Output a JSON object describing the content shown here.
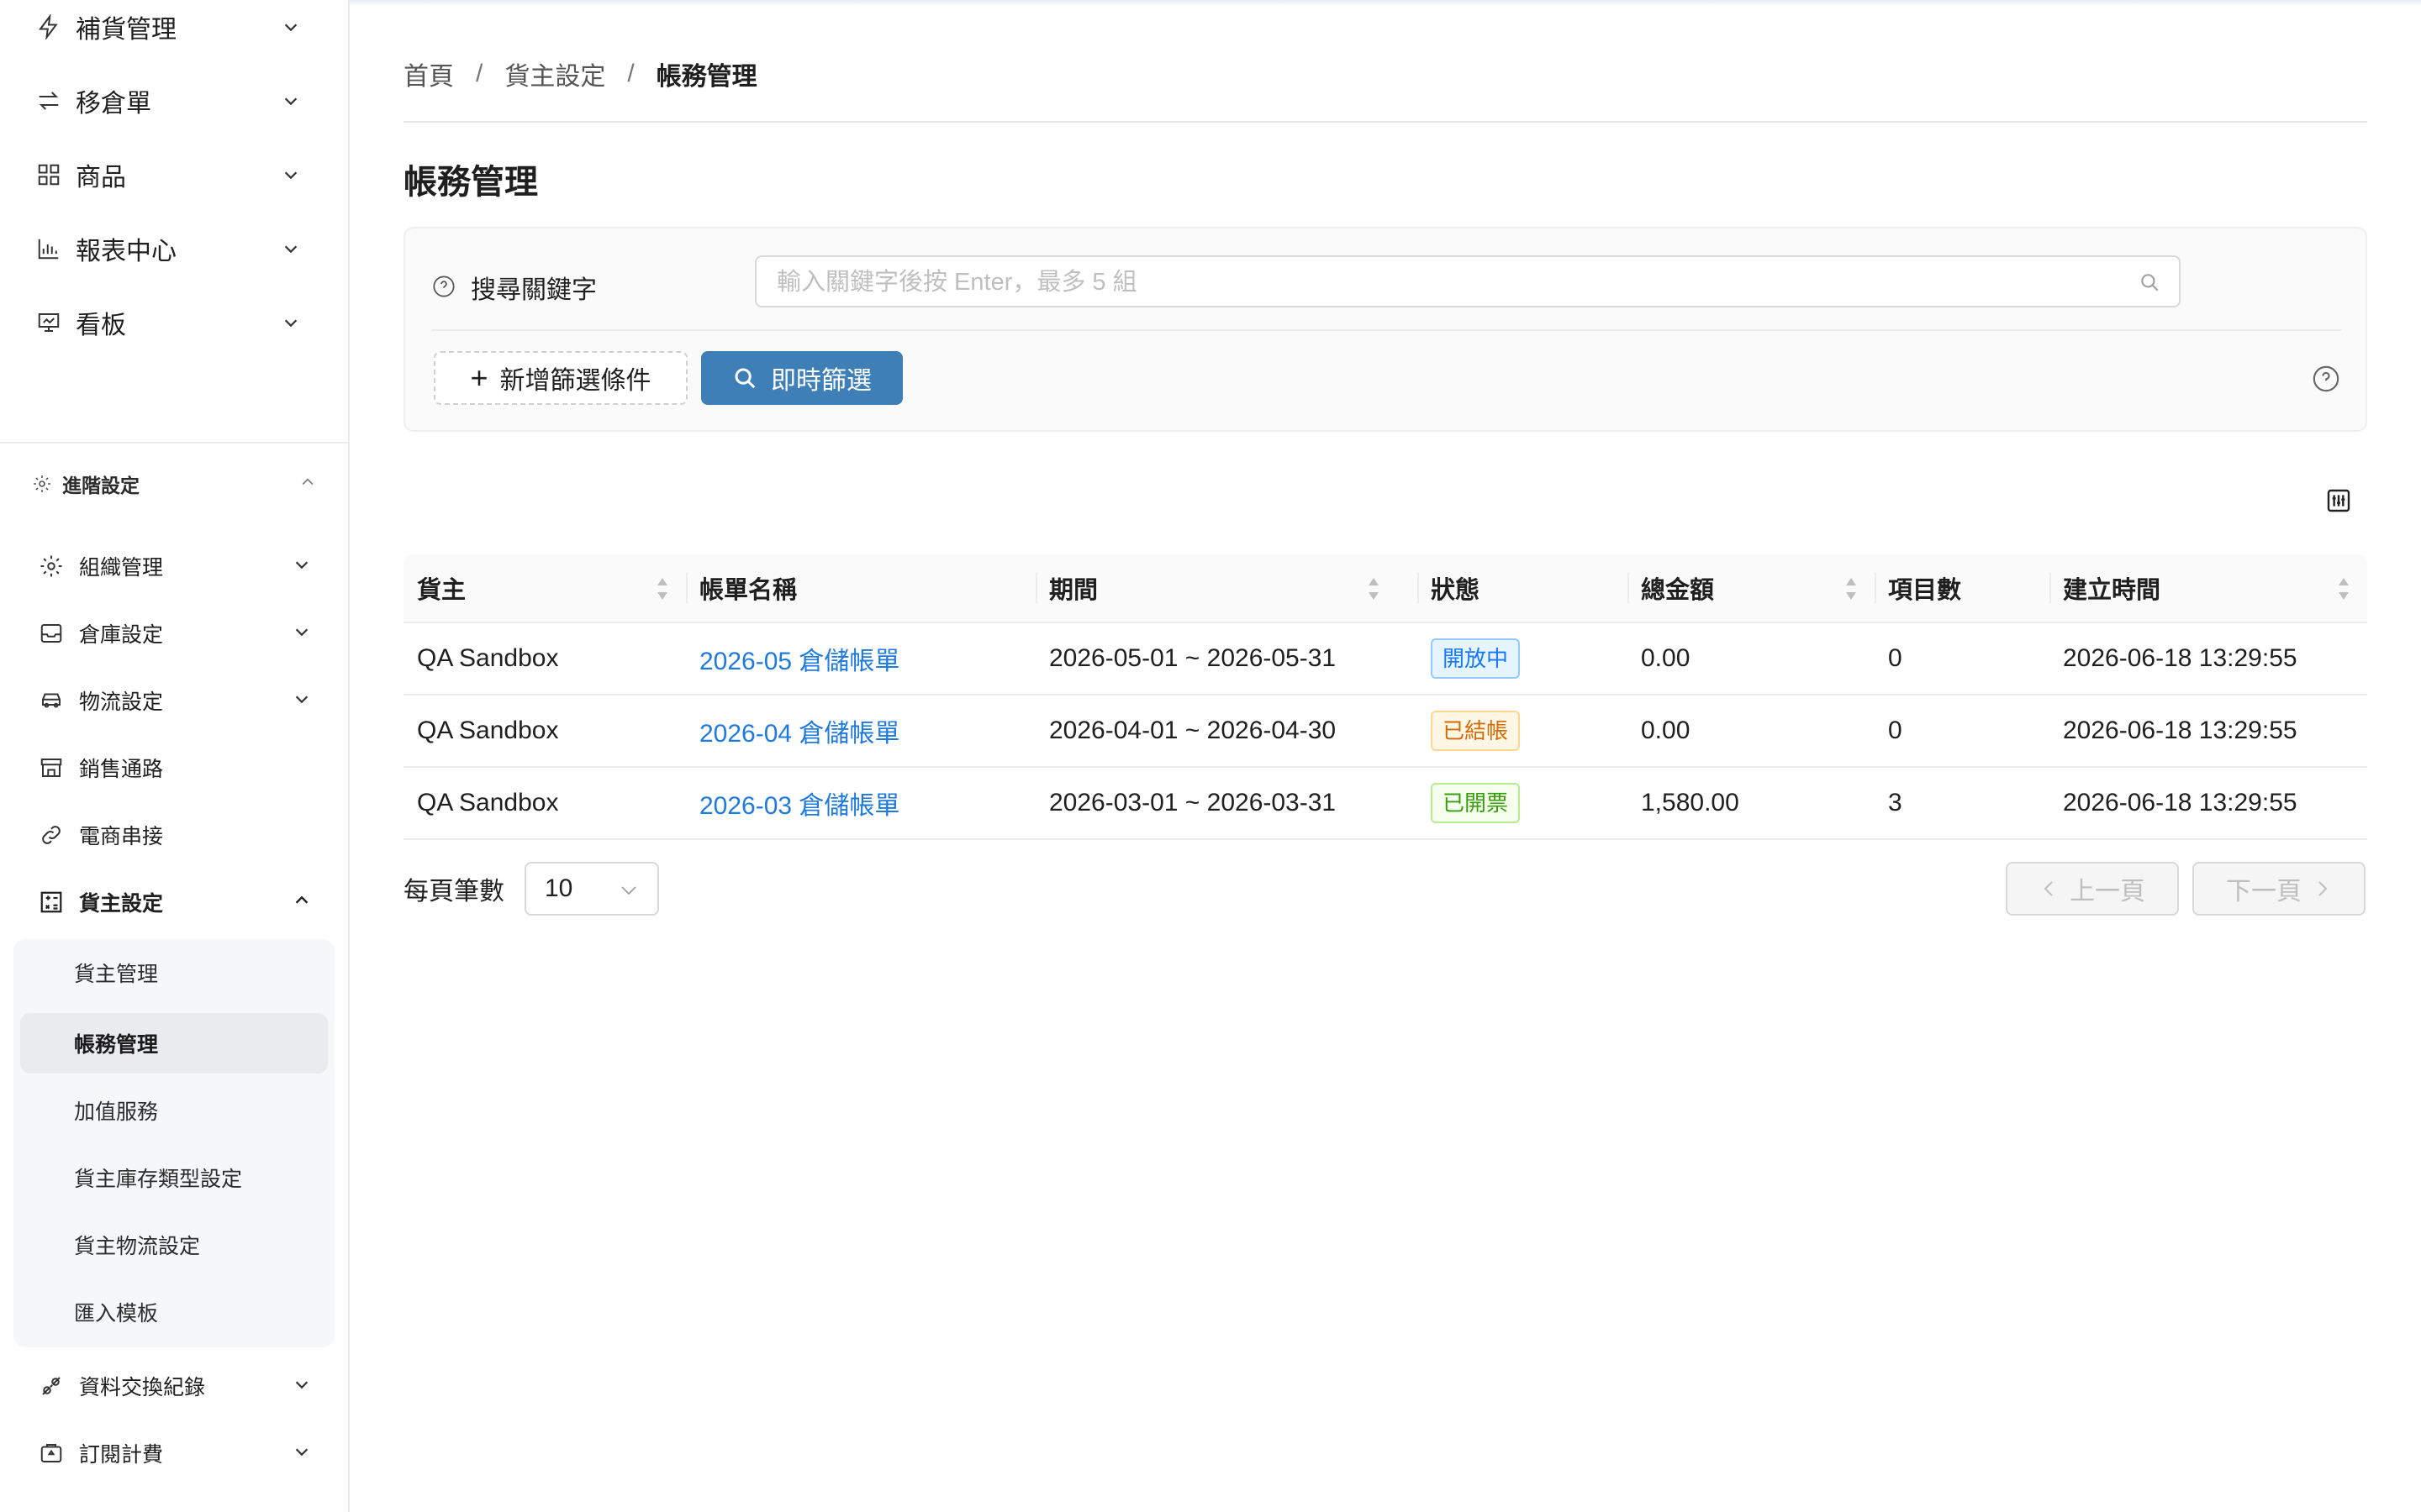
{
  "sidebar": {
    "top_items": [
      {
        "label": "補貨管理",
        "icon": "lightning-icon"
      },
      {
        "label": "移倉單",
        "icon": "transfer-arrows-icon"
      },
      {
        "label": "商品",
        "icon": "grid-icon"
      },
      {
        "label": "報表中心",
        "icon": "bar-chart-icon"
      },
      {
        "label": "看板",
        "icon": "presentation-board-icon"
      }
    ],
    "section": {
      "label": "進階設定",
      "icon": "gear-icon"
    },
    "items": [
      {
        "label": "組織管理",
        "icon": "gear-icon"
      },
      {
        "label": "倉庫設定",
        "icon": "inbox-icon"
      },
      {
        "label": "物流設定",
        "icon": "car-icon"
      },
      {
        "label": "銷售通路",
        "icon": "shop-icon"
      },
      {
        "label": "電商串接",
        "icon": "link-icon"
      },
      {
        "label": "貨主設定",
        "icon": "calculator-icon"
      }
    ],
    "sub_items": [
      "貨主管理",
      "帳務管理",
      "加值服務",
      "貨主庫存類型設定",
      "貨主物流設定",
      "匯入模板"
    ],
    "bottom_items": [
      {
        "label": "資料交換紀錄",
        "icon": "api-icon"
      },
      {
        "label": "訂閱計費",
        "icon": "subscription-icon"
      }
    ]
  },
  "breadcrumb": [
    "首頁",
    "貨主設定",
    "帳務管理"
  ],
  "page_title": "帳務管理",
  "filter": {
    "keyword_label": "搜尋關鍵字",
    "search_placeholder": "輸入關鍵字後按 Enter，最多 5 組",
    "search_value": "",
    "add_condition_label": "新增篩選條件",
    "instant_filter_label": "即時篩選"
  },
  "table": {
    "columns": [
      "貨主",
      "帳單名稱",
      "期間",
      "狀態",
      "總金額",
      "項目數",
      "建立時間"
    ],
    "rows": [
      {
        "owner": "QA Sandbox",
        "name": "2026-05 倉儲帳單",
        "period": "2026-05-01 ~ 2026-05-31",
        "status": "開放中",
        "status_kind": "open",
        "amount": "0.00",
        "count": "0",
        "created": "2026-06-18 13:29:55"
      },
      {
        "owner": "QA Sandbox",
        "name": "2026-04 倉儲帳單",
        "period": "2026-04-01 ~ 2026-04-30",
        "status": "已結帳",
        "status_kind": "closed",
        "amount": "0.00",
        "count": "0",
        "created": "2026-06-18 13:29:55"
      },
      {
        "owner": "QA Sandbox",
        "name": "2026-03 倉儲帳單",
        "period": "2026-03-01 ~ 2026-03-31",
        "status": "已開票",
        "status_kind": "invoiced",
        "amount": "1,580.00",
        "count": "3",
        "created": "2026-06-18 13:29:55"
      }
    ]
  },
  "pagination": {
    "page_size_label": "每頁筆數",
    "page_size": "10",
    "prev_label": "上一頁",
    "next_label": "下一頁"
  },
  "colors": {
    "primary": "#3f7fb8",
    "link": "#1f7ae0",
    "status_open": "#1677ff",
    "status_closed": "#fa8c16",
    "status_invoiced": "#52c41a"
  }
}
